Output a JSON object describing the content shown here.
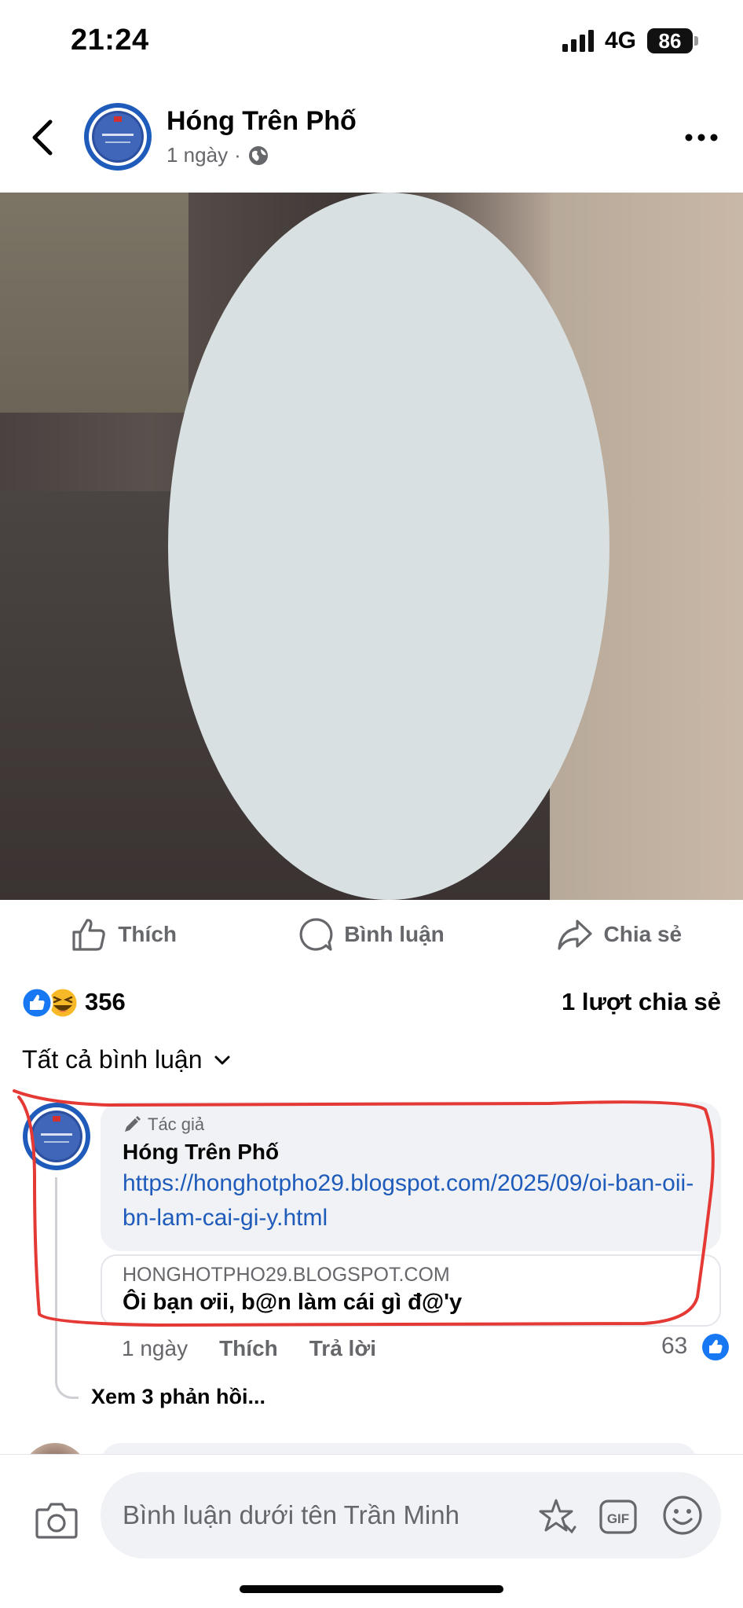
{
  "status_bar": {
    "time": "21:24",
    "network": "4G",
    "battery": "86"
  },
  "header": {
    "page_name": "Hóng Trên Phố",
    "time_ago": "1 ngày",
    "separator": "·",
    "privacy_icon": "globe-icon"
  },
  "actions": {
    "like": "Thích",
    "comment": "Bình luận",
    "share": "Chia sẻ"
  },
  "reactions": {
    "icons": [
      "like-reaction-icon",
      "haha-reaction-icon"
    ],
    "count": "356",
    "shares": "1 lượt chia sẻ"
  },
  "comments_filter": {
    "label": "Tất cả bình luận"
  },
  "comment": {
    "badge": "Tác giả",
    "author": "Hóng Trên Phố",
    "link": "https://honghotpho29.blogspot.com/2025/09/oi-ban-oii-bn-lam-cai-gi-y.html",
    "preview_domain": "HONGHOTPHO29.BLOGSPOT.COM",
    "preview_title": "Ôi bạn ơii, b@n làm cái gì đ@'y",
    "time_ago": "1 ngày",
    "like_label": "Thích",
    "reply_label": "Trả lời",
    "like_count": "63",
    "view_replies": "Xem 3 phản hồi..."
  },
  "composer": {
    "placeholder": "Bình luận dưới tên Trần Minh",
    "gif_label": "GIF"
  },
  "colors": {
    "accent": "#1877f2",
    "link": "#1f5bbb",
    "annotation": "#e53935",
    "muted": "#65676b"
  }
}
